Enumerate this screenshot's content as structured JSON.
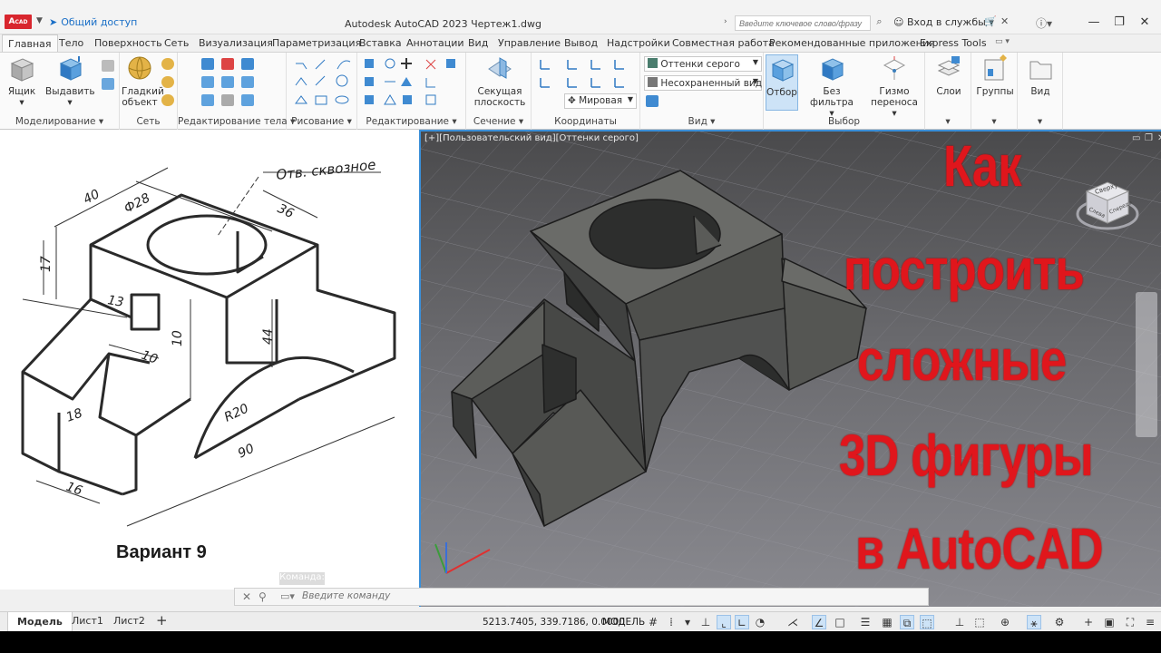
{
  "titlebar": {
    "logo": "A",
    "logo_sub": "CAD",
    "share": "Общий доступ",
    "app_title": "Autodesk AutoCAD 2023    Чертеж1.dwg",
    "search_placeholder": "Введите ключевое слово/фразу",
    "signin": "Вход в службы"
  },
  "tabs": [
    "Главная",
    "Тело",
    "Поверхность",
    "Сеть",
    "Визуализация",
    "Параметризация",
    "Вставка",
    "Аннотации",
    "Вид",
    "Управление",
    "Вывод",
    "Надстройки",
    "Совместная работа",
    "Рекомендованные приложения",
    "Express Tools"
  ],
  "ribbon": {
    "modeling": {
      "title": "Моделирование",
      "box": "Ящик",
      "extrude": "Выдавить"
    },
    "mesh": {
      "title": "Сеть",
      "smooth1": "Гладкий",
      "smooth2": "объект"
    },
    "solid_edit": {
      "title": "Редактирование тела"
    },
    "draw": {
      "title": "Рисование"
    },
    "modify": {
      "title": "Редактирование"
    },
    "section": {
      "title": "Сечение",
      "plane1": "Секущая",
      "plane2": "плоскость"
    },
    "coords": {
      "title": "Координаты",
      "world": "Мировая"
    },
    "view": {
      "title": "Вид",
      "visual_style": "Оттенки серого",
      "named_view": "Несохраненный вид"
    },
    "selection": {
      "title": "Выбор",
      "cull": "Отбор",
      "nofilter": "Без фильтра",
      "gizmo1": "Гизмо",
      "gizmo2": "переноса"
    },
    "layers": "Слои",
    "groups": "Группы",
    "view_btn": "Вид"
  },
  "drawing": {
    "hole_note": "Отв. сквозное",
    "dims": [
      "40",
      "Ф28",
      "36",
      "17",
      "13",
      "10",
      "10",
      "44",
      "18",
      "R20",
      "90",
      "16"
    ],
    "variant": "Вариант 9"
  },
  "viewport": {
    "label": "[+][Пользовательский вид][Оттенки серого]",
    "viewcube_top": "Сверху",
    "viewcube_front": "Слева",
    "viewcube_right": "Спереди"
  },
  "overlay": [
    "Как",
    "построить",
    "сложные",
    "3D фигуры",
    "в AutoCAD"
  ],
  "command": {
    "placeholder": "Введите команду",
    "tag": "Команда:"
  },
  "status": {
    "layouts": [
      "Модель",
      "Лист1",
      "Лист2"
    ],
    "coords": "5213.7405, 339.7186, 0.0000",
    "mode": "МОДЕЛЬ"
  },
  "colors": {
    "accent": "#3a8fd8",
    "overlay_red": "#e0161c",
    "logo_red": "#d8262e"
  }
}
